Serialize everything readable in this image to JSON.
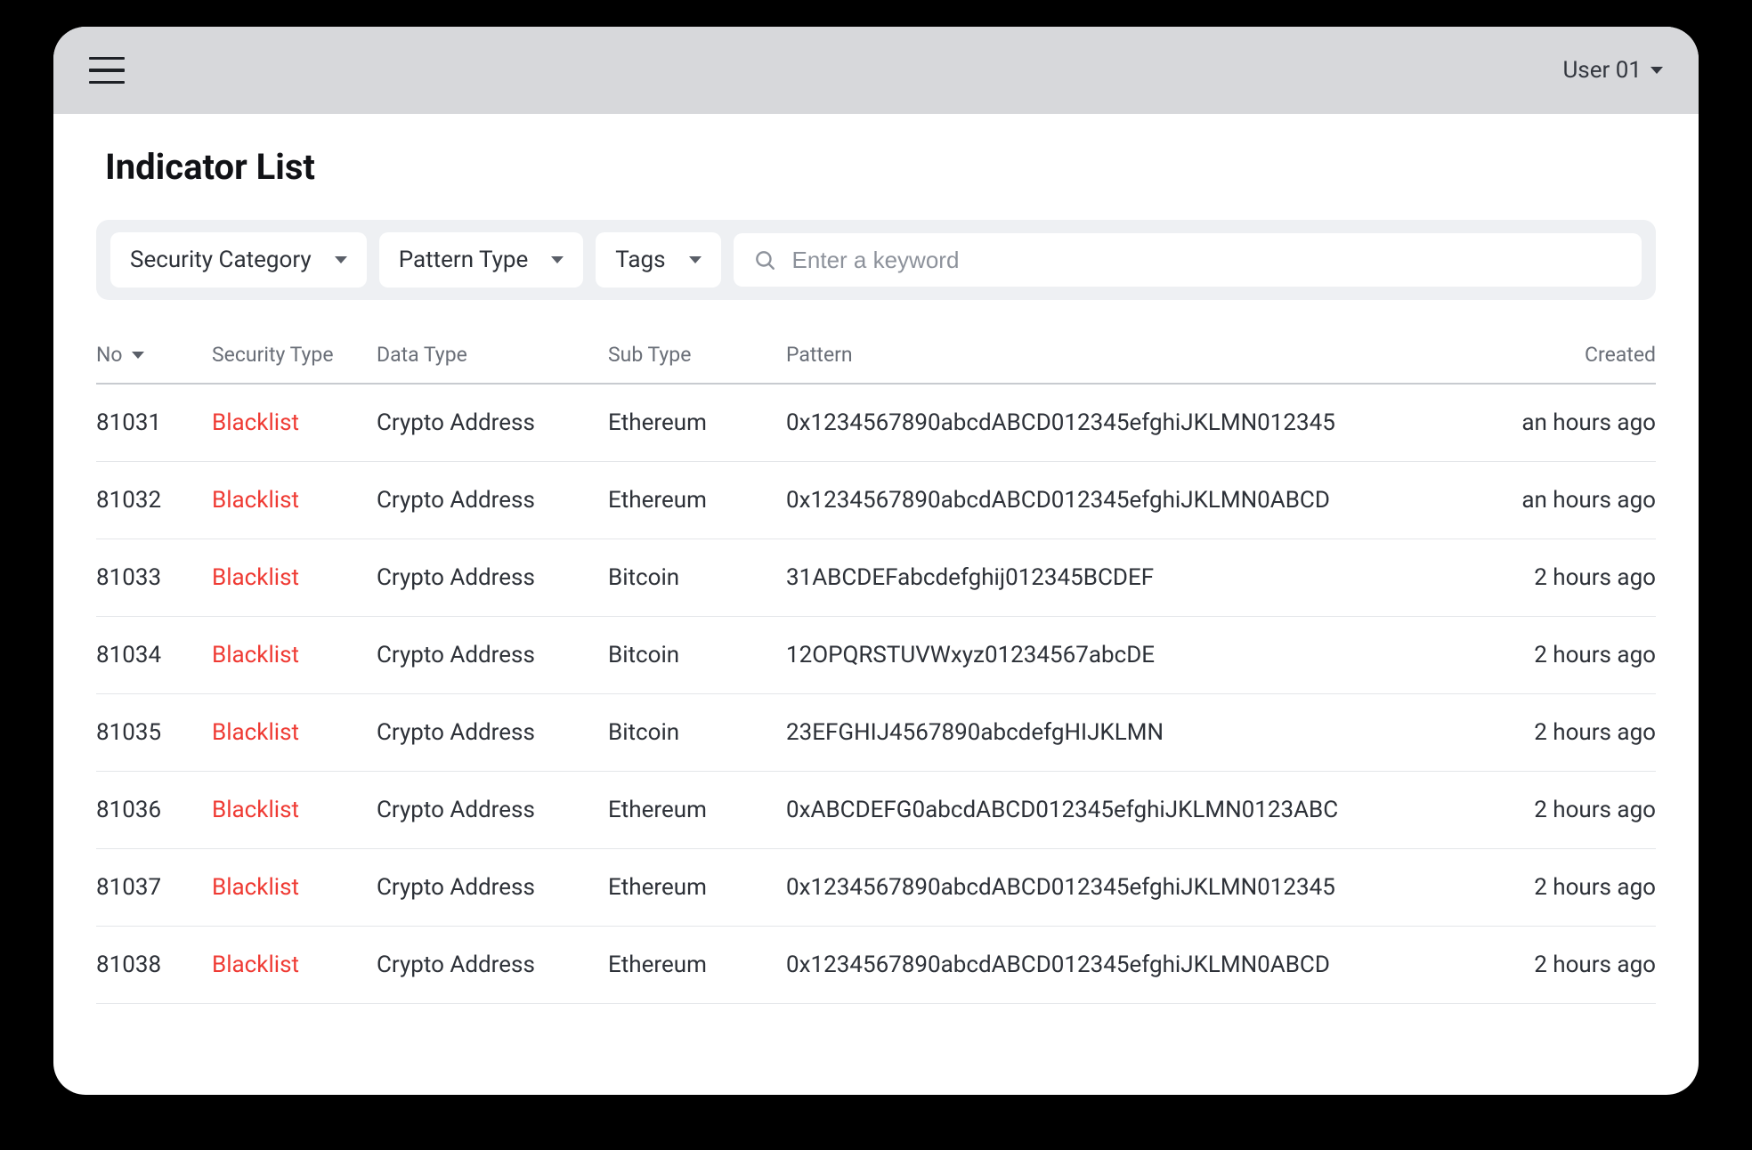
{
  "header": {
    "user_label": "User 01"
  },
  "page": {
    "title": "Indicator List"
  },
  "filters": {
    "security_category_label": "Security Category",
    "pattern_type_label": "Pattern Type",
    "tags_label": "Tags",
    "search_placeholder": "Enter a keyword"
  },
  "table": {
    "columns": {
      "no": "No",
      "security_type": "Security Type",
      "data_type": "Data Type",
      "sub_type": "Sub Type",
      "pattern": "Pattern",
      "created": "Created"
    },
    "rows": [
      {
        "no": "81031",
        "security_type": "Blacklist",
        "data_type": "Crypto Address",
        "sub_type": "Ethereum",
        "pattern": "0x1234567890abcdABCD012345efghiJKLMN012345",
        "created": "an hours ago"
      },
      {
        "no": "81032",
        "security_type": "Blacklist",
        "data_type": "Crypto Address",
        "sub_type": "Ethereum",
        "pattern": "0x1234567890abcdABCD012345efghiJKLMN0ABCD",
        "created": "an hours ago"
      },
      {
        "no": "81033",
        "security_type": "Blacklist",
        "data_type": "Crypto Address",
        "sub_type": "Bitcoin",
        "pattern": "31ABCDEFabcdefghij012345BCDEF",
        "created": "2 hours ago"
      },
      {
        "no": "81034",
        "security_type": "Blacklist",
        "data_type": "Crypto Address",
        "sub_type": "Bitcoin",
        "pattern": "12OPQRSTUVWxyz01234567abcDE",
        "created": "2 hours ago"
      },
      {
        "no": "81035",
        "security_type": "Blacklist",
        "data_type": "Crypto Address",
        "sub_type": "Bitcoin",
        "pattern": "23EFGHIJ4567890abcdefgHIJKLMN",
        "created": "2 hours ago"
      },
      {
        "no": "81036",
        "security_type": "Blacklist",
        "data_type": "Crypto Address",
        "sub_type": "Ethereum",
        "pattern": "0xABCDEFG0abcdABCD012345efghiJKLMN0123ABC",
        "created": "2 hours ago"
      },
      {
        "no": "81037",
        "security_type": "Blacklist",
        "data_type": "Crypto Address",
        "sub_type": "Ethereum",
        "pattern": "0x1234567890abcdABCD012345efghiJKLMN012345",
        "created": "2 hours ago"
      },
      {
        "no": "81038",
        "security_type": "Blacklist",
        "data_type": "Crypto Address",
        "sub_type": "Ethereum",
        "pattern": "0x1234567890abcdABCD012345efghiJKLMN0ABCD",
        "created": "2 hours ago"
      }
    ]
  }
}
